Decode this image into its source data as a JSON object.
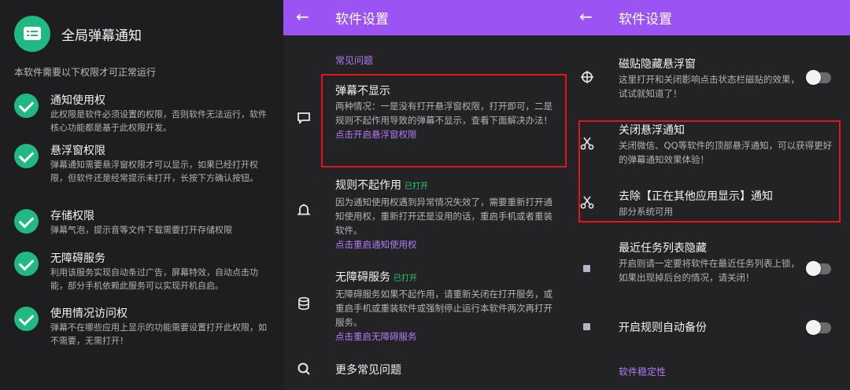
{
  "left": {
    "title": "全局弹幕通知",
    "intro": "本软件需要以下权限才可正常运行",
    "perms": [
      {
        "title": "通知使用权",
        "desc": "此权限是软件必须设置的权限，否则软件无法运行，软件核心功能都是基于此权限开发。"
      },
      {
        "title": "悬浮窗权限",
        "desc": "弹幕通知需要悬浮窗权限才可以显示，如果已经打开权限，但软件还是经常提示未打开，长按下方确认按钮。"
      },
      {
        "title": "存储权限",
        "desc": "弹幕气泡，提示音等文件下载需要打开存储权限"
      },
      {
        "title": "无障碍服务",
        "desc": "利用该服务实现自动条过广告，屏幕特效，自动点击功能，部分手机依赖此服务可以实现开机自启。"
      },
      {
        "title": "使用情况访问权",
        "desc": "弹幕不在哪些应用上显示的功能需要设置打开此权限，如不需要，无需打开！"
      }
    ]
  },
  "middle": {
    "back": "←",
    "title": "软件设置",
    "section": "常见问题",
    "items": [
      {
        "title": "弹幕不显示",
        "tag": "",
        "desc": "两种情况：一是没有打开悬浮窗权限，打开即可，二是规则不起作用导致的弹幕不显示，查看下面解决办法！",
        "link": "点击开启悬浮窗权限"
      },
      {
        "title": "规则不起作用",
        "tag": "已打开",
        "desc": "因为通知使用权遇到异常情况失效了，需要重新打开通知使用权，重新打开还是没用的话，重启手机或者重装软件。",
        "link": "点击重启通知使用权"
      },
      {
        "title": "无障碍服务",
        "tag": "已打开",
        "desc": "无障碍服务如果不起作用，请重新关闭在打开服务，或重启手机或重装软件或强制停止运行本软件两次再打开服务。",
        "link": "点击重启无障碍服务"
      },
      {
        "title": "更多常见问题",
        "tag": "",
        "desc": "",
        "link": ""
      }
    ]
  },
  "right": {
    "back": "←",
    "title": "软件设置",
    "items": [
      {
        "title": "磁贴隐藏悬浮窗",
        "desc": "这里打开和关闭影响点击状态栏磁贴的效果，试试就知道了！",
        "toggle": false
      },
      {
        "title": "关闭悬浮通知",
        "desc": "关闭微信、QQ等软件的顶部悬浮通知，可以获得更好的弹幕通知效果体验！"
      },
      {
        "title": "去除【正在其他应用显示】通知",
        "desc": "部分系统可用"
      },
      {
        "title": "最近任务列表隐藏",
        "desc": "开启则请一定要将软件在最近任务列表上锁，如果出现掉后台的情况，请关闭！",
        "toggle": false
      },
      {
        "title": "开启规则自动备份",
        "desc": "",
        "toggle": false
      }
    ],
    "section": "软件稳定性"
  },
  "colors": {
    "accent": "#9b54f3",
    "check": "#1fb981",
    "link": "#b07cf6",
    "highlight": "#e0161b"
  }
}
